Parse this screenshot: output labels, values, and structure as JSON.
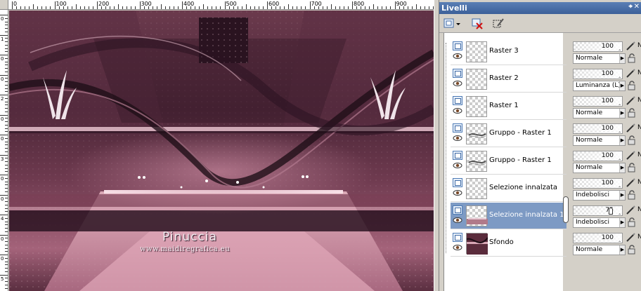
{
  "ruler": {
    "top_labels": [
      "0",
      "100",
      "200",
      "300",
      "400",
      "500",
      "600",
      "700",
      "800",
      "900"
    ],
    "left_labels": [
      "0",
      "1",
      "0",
      "0",
      "2",
      "0",
      "0",
      "3",
      "0",
      "0",
      "4",
      "0",
      "0",
      "5"
    ]
  },
  "canvas": {
    "signature": "Pinuccia",
    "website": "www.maidiregrafica.eu"
  },
  "panel": {
    "title": "Livelli",
    "pin_icon": "pin-icon",
    "close_icon": "close-icon",
    "toolbar": {
      "new_layer_icon": "new-raster-layer-icon",
      "delete_icon": "delete-layer-icon",
      "mask_icon": "edit-selection-icon"
    },
    "layers": [
      {
        "name": "Raster 3",
        "opacity": "100",
        "blend": "Normale",
        "selected": false,
        "type": "raster"
      },
      {
        "name": "Raster 2",
        "opacity": "100",
        "blend": "Luminanza (L)",
        "selected": false,
        "type": "raster"
      },
      {
        "name": "Raster 1",
        "opacity": "100",
        "blend": "Normale",
        "selected": false,
        "type": "raster"
      },
      {
        "name": "Gruppo - Raster 1",
        "opacity": "100",
        "blend": "Normale",
        "selected": false,
        "type": "group"
      },
      {
        "name": "Gruppo - Raster 1",
        "opacity": "100",
        "blend": "Normale",
        "selected": false,
        "type": "group"
      },
      {
        "name": "Selezione innalzata",
        "opacity": "100",
        "blend": "Indebolisci",
        "selected": false,
        "type": "raster"
      },
      {
        "name": "Selezione innalzata 1",
        "opacity": "75",
        "blend": "Indebolisci",
        "selected": true,
        "type": "raster"
      },
      {
        "name": "Sfondo",
        "opacity": "100",
        "blend": "Normale",
        "selected": false,
        "type": "background"
      }
    ],
    "extra_glyph": "N"
  },
  "colors": {
    "selection": "#7d9ac4",
    "title_bar": "#3b5f99",
    "art_dark": "#3a1c2c",
    "art_mid": "#8a5266",
    "art_light": "#d9a3b3"
  }
}
